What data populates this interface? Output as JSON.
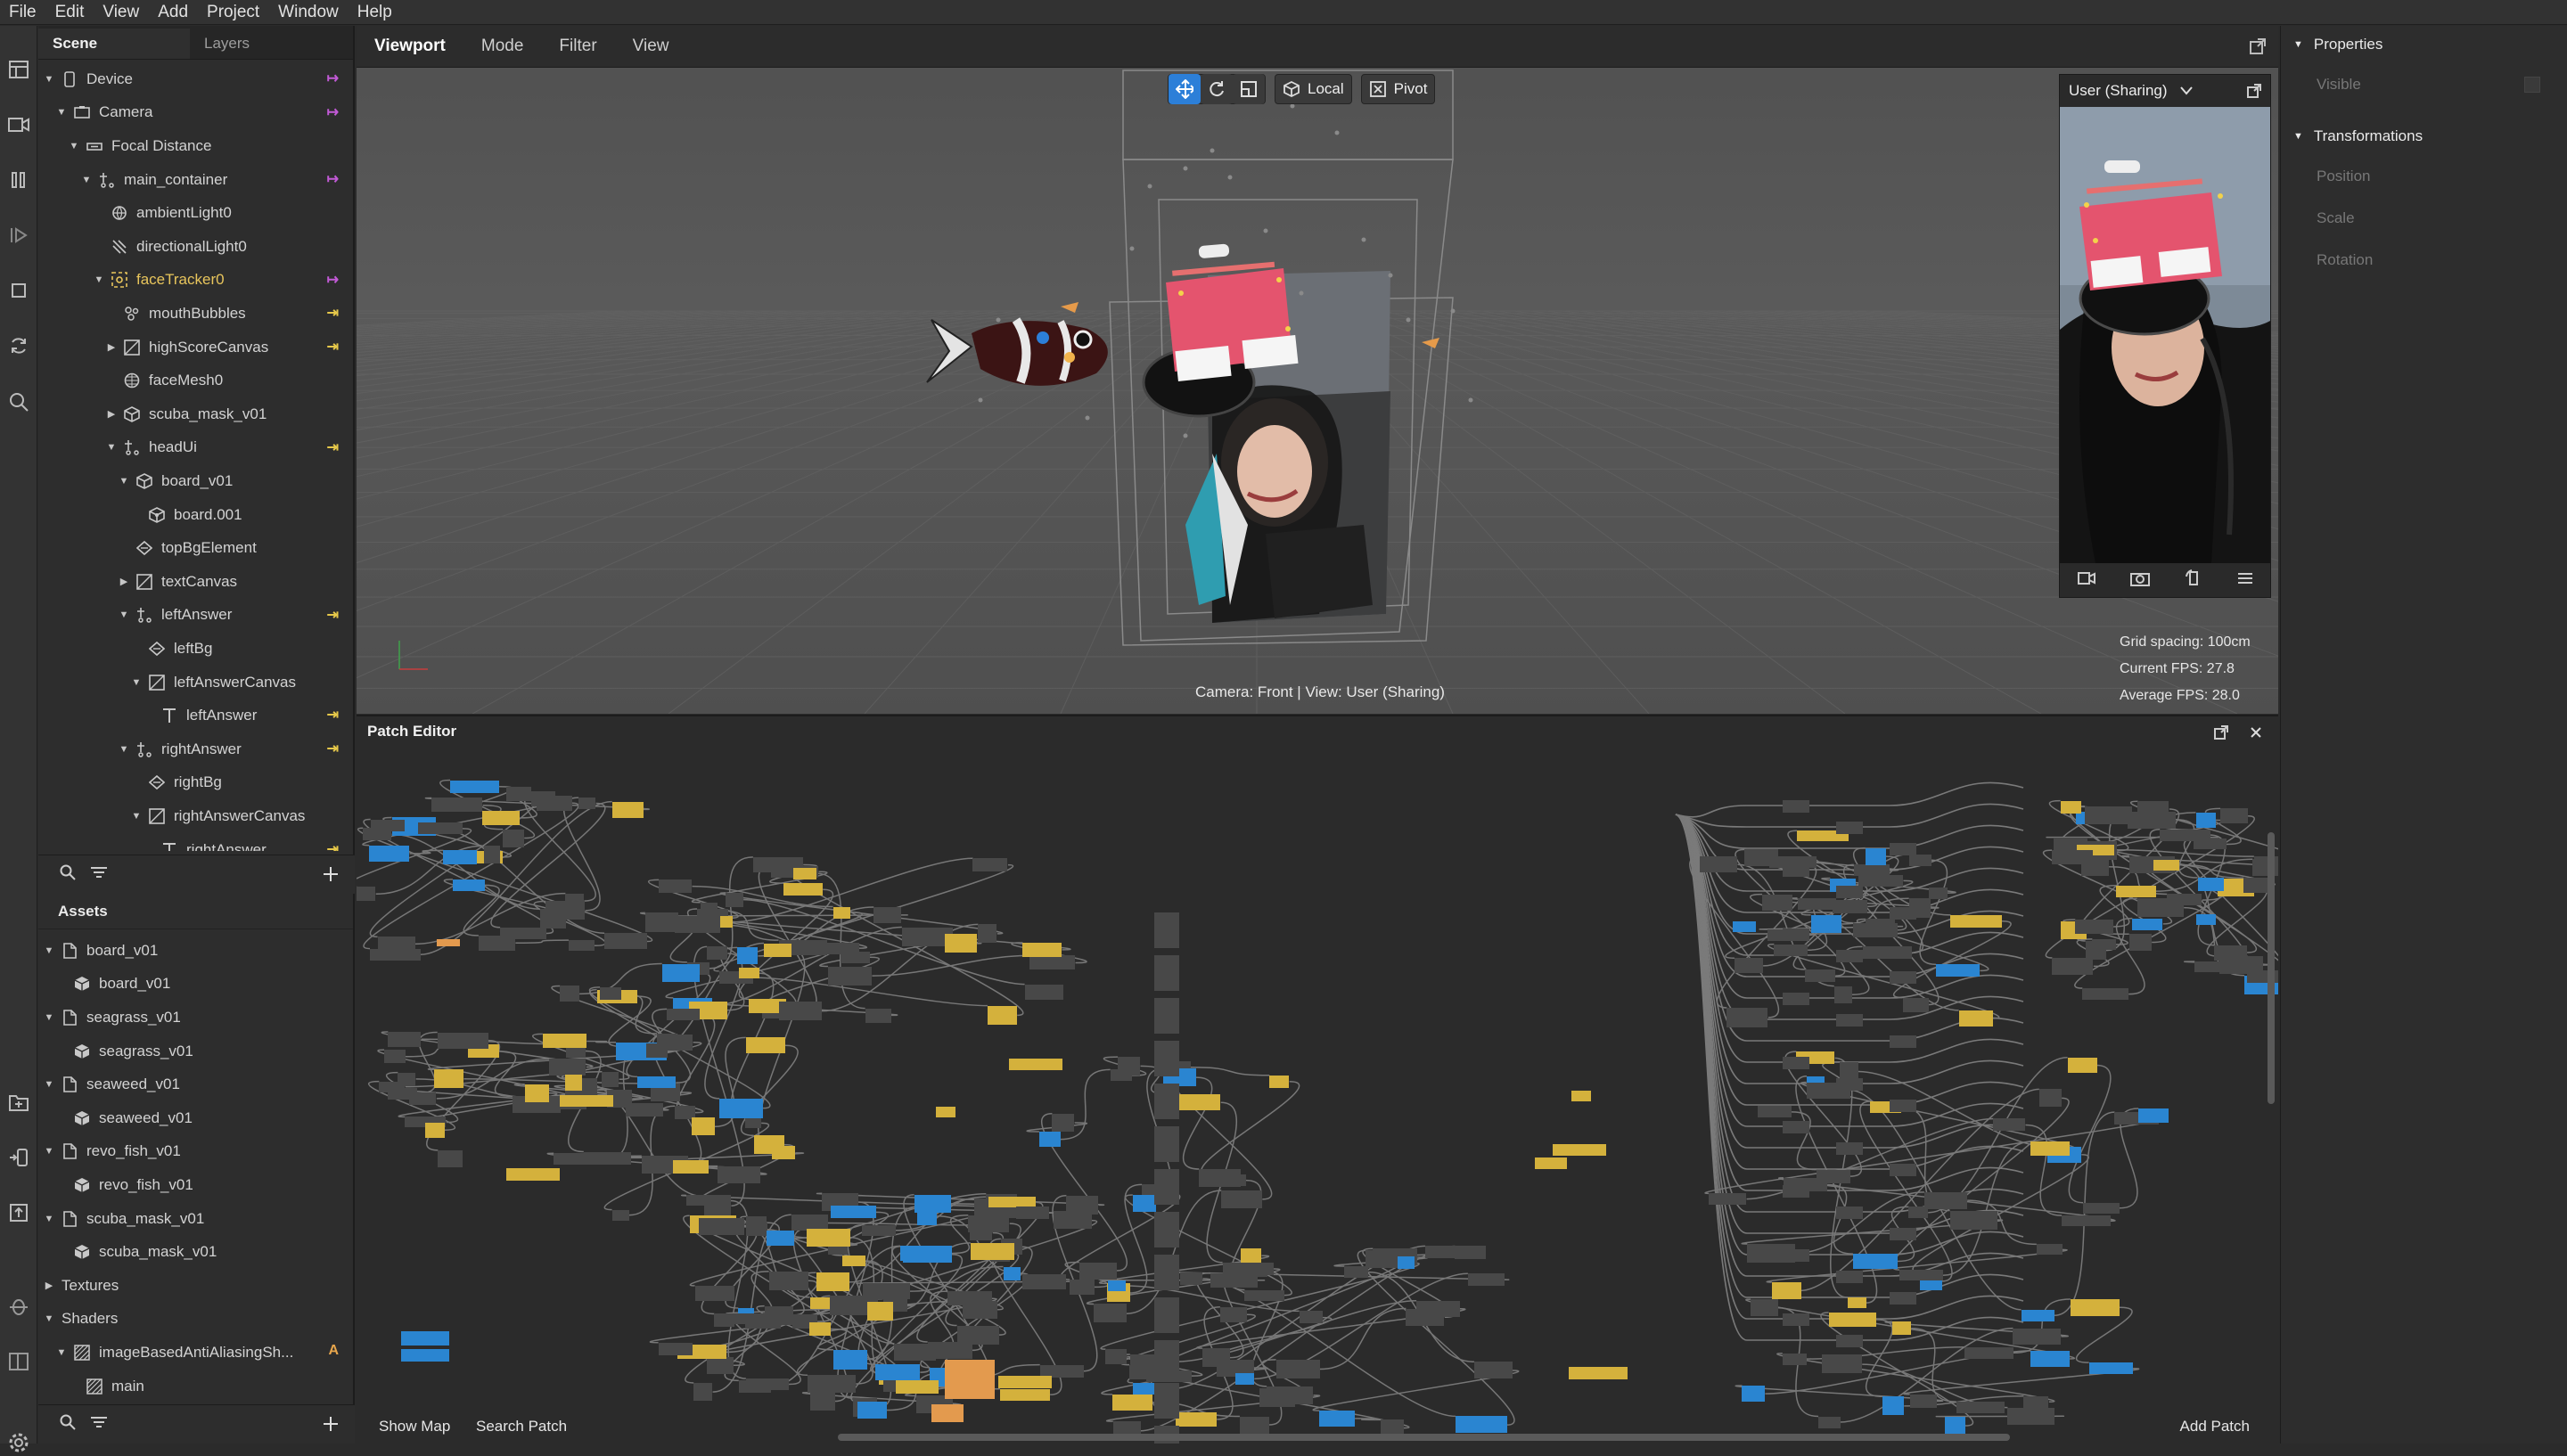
{
  "menu": [
    "File",
    "Edit",
    "View",
    "Add",
    "Project",
    "Window",
    "Help"
  ],
  "scene": {
    "tabs": [
      "Scene",
      "Layers"
    ],
    "tree": [
      {
        "label": "Device",
        "level": 0,
        "expanded": true,
        "icon": "device-icon",
        "link": "pink"
      },
      {
        "label": "Camera",
        "level": 1,
        "expanded": true,
        "icon": "camera-icon",
        "link": "pink"
      },
      {
        "label": "Focal Distance",
        "level": 2,
        "expanded": true,
        "icon": "focal-icon",
        "link": ""
      },
      {
        "label": "main_container",
        "level": 3,
        "expanded": true,
        "icon": "null-object-icon",
        "link": "pink"
      },
      {
        "label": "ambientLight0",
        "level": 4,
        "expanded": null,
        "icon": "ambient-light-icon",
        "link": ""
      },
      {
        "label": "directionalLight0",
        "level": 4,
        "expanded": null,
        "icon": "directional-light-icon",
        "link": ""
      },
      {
        "label": "faceTracker0",
        "level": 4,
        "expanded": true,
        "icon": "face-tracker-icon",
        "link": "pink",
        "selected": true
      },
      {
        "label": "mouthBubbles",
        "level": 5,
        "expanded": null,
        "icon": "particle-icon",
        "link": "yellow"
      },
      {
        "label": "highScoreCanvas",
        "level": 5,
        "expanded": false,
        "icon": "canvas-icon",
        "link": "yellow"
      },
      {
        "label": "faceMesh0",
        "level": 5,
        "expanded": null,
        "icon": "mesh-icon",
        "link": ""
      },
      {
        "label": "scuba_mask_v01",
        "level": 5,
        "expanded": false,
        "icon": "object-icon",
        "link": ""
      },
      {
        "label": "headUi",
        "level": 5,
        "expanded": true,
        "icon": "null-object-icon",
        "link": "yellow"
      },
      {
        "label": "board_v01",
        "level": 6,
        "expanded": true,
        "icon": "object-icon",
        "link": ""
      },
      {
        "label": "board.001",
        "level": 7,
        "expanded": null,
        "icon": "mesh-object-icon",
        "link": ""
      },
      {
        "label": "topBgElement",
        "level": 6,
        "expanded": null,
        "icon": "rectangle-icon",
        "link": ""
      },
      {
        "label": "textCanvas",
        "level": 6,
        "expanded": false,
        "icon": "canvas-icon",
        "link": ""
      },
      {
        "label": "leftAnswer",
        "level": 6,
        "expanded": true,
        "icon": "null-object-icon",
        "link": "yellow"
      },
      {
        "label": "leftBg",
        "level": 7,
        "expanded": null,
        "icon": "rectangle-icon",
        "link": ""
      },
      {
        "label": "leftAnswerCanvas",
        "level": 7,
        "expanded": true,
        "icon": "canvas-icon",
        "link": ""
      },
      {
        "label": "leftAnswer",
        "level": 8,
        "expanded": null,
        "icon": "text-icon",
        "link": "yellow"
      },
      {
        "label": "rightAnswer",
        "level": 6,
        "expanded": true,
        "icon": "null-object-icon",
        "link": "yellow"
      },
      {
        "label": "rightBg",
        "level": 7,
        "expanded": null,
        "icon": "rectangle-icon",
        "link": ""
      },
      {
        "label": "rightAnswerCanvas",
        "level": 7,
        "expanded": true,
        "icon": "canvas-icon",
        "link": ""
      },
      {
        "label": "rightAnswer",
        "level": 8,
        "expanded": null,
        "icon": "text-icon",
        "link": "yellow"
      }
    ]
  },
  "assets": {
    "title": "Assets",
    "tree": [
      {
        "label": "board_v01",
        "level": 0,
        "expanded": true,
        "icon": "file-icon",
        "badge": ""
      },
      {
        "label": "board_v01",
        "level": 1,
        "expanded": null,
        "icon": "cube-icon",
        "badge": ""
      },
      {
        "label": "seagrass_v01",
        "level": 0,
        "expanded": true,
        "icon": "file-icon",
        "badge": ""
      },
      {
        "label": "seagrass_v01",
        "level": 1,
        "expanded": null,
        "icon": "cube-icon",
        "badge": ""
      },
      {
        "label": "seaweed_v01",
        "level": 0,
        "expanded": true,
        "icon": "file-icon",
        "badge": ""
      },
      {
        "label": "seaweed_v01",
        "level": 1,
        "expanded": null,
        "icon": "cube-icon",
        "badge": ""
      },
      {
        "label": "revo_fish_v01",
        "level": 0,
        "expanded": true,
        "icon": "file-icon",
        "badge": ""
      },
      {
        "label": "revo_fish_v01",
        "level": 1,
        "expanded": null,
        "icon": "cube-icon",
        "badge": ""
      },
      {
        "label": "scuba_mask_v01",
        "level": 0,
        "expanded": true,
        "icon": "file-icon",
        "badge": ""
      },
      {
        "label": "scuba_mask_v01",
        "level": 1,
        "expanded": null,
        "icon": "cube-icon",
        "badge": ""
      },
      {
        "label": "Textures",
        "level": 0,
        "expanded": false,
        "icon": "",
        "badge": ""
      },
      {
        "label": "Shaders",
        "level": 0,
        "expanded": true,
        "icon": "",
        "badge": ""
      },
      {
        "label": "imageBasedAntiAliasingSh...",
        "level": 1,
        "expanded": true,
        "icon": "shader-icon",
        "badge": "A"
      },
      {
        "label": "main",
        "level": 2,
        "expanded": null,
        "icon": "shader-icon",
        "badge": ""
      }
    ]
  },
  "viewport": {
    "tabs": [
      "Viewport",
      "Mode",
      "Filter",
      "View"
    ],
    "tools": {
      "local": "Local",
      "pivot": "Pivot"
    },
    "camera_label": "Camera: Front | View: User (Sharing)",
    "preview": {
      "title": "User (Sharing)"
    },
    "stats": [
      "Grid spacing:  100cm",
      "Current FPS:  27.8",
      "Average FPS:  28.0"
    ]
  },
  "patch": {
    "title": "Patch Editor",
    "show_map": "Show Map",
    "search_patch": "Search Patch",
    "add_patch": "Add Patch"
  },
  "properties": {
    "title": "Properties",
    "visible_label": "Visible",
    "transform_title": "Transformations",
    "rows": [
      "Position",
      "Scale",
      "Rotation"
    ]
  },
  "colors": {
    "accent": "#2c7fd8",
    "link_pink": "#c25ad6",
    "link_yellow": "#e6c84a",
    "patch_yellow": "#d4b13c",
    "patch_blue": "#2a85d1",
    "patch_orange": "#e39a4e",
    "patch_node": "#484848"
  }
}
